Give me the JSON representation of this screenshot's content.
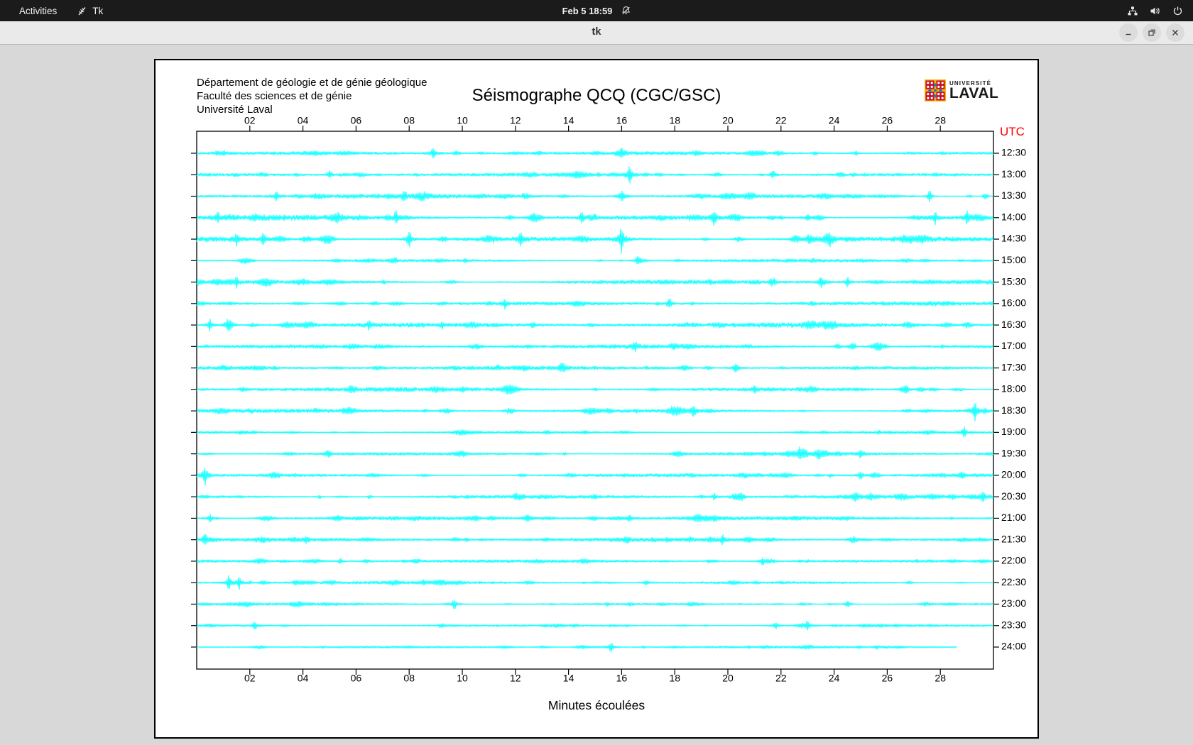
{
  "top_bar": {
    "activities_label": "Activities",
    "app_menu_label": "Tk",
    "clock": "Feb 5 18:59"
  },
  "titlebar": {
    "title": "tk"
  },
  "app": {
    "institution_lines": [
      "Département de géologie et de génie géologique",
      "Faculté des sciences et de génie",
      "Université Laval"
    ],
    "title": "Séismographe QCQ (CGC/GSC)",
    "logo": {
      "top": "UNIVERSITÉ",
      "bottom": "LAVAL"
    },
    "utc_label": "UTC",
    "x_axis_label": "Minutes écoulées"
  },
  "colors": {
    "trace": "#00ffff",
    "utc_label": "#ff0000",
    "plot_frame": "#000000",
    "topbar_bg": "#1b1b1b",
    "titlebar_bg": "#eaeaea",
    "desktop_bg": "#d8d8d8"
  },
  "chart_data": {
    "type": "line",
    "subtype": "helicorder-seismogram",
    "title": "Séismographe QCQ (CGC/GSC)",
    "x_label": "Minutes écoulées",
    "right_axis_label": "UTC",
    "x_range_minutes": [
      0,
      30
    ],
    "x_tick_minutes": [
      2,
      4,
      6,
      8,
      10,
      12,
      14,
      16,
      18,
      20,
      22,
      24,
      26,
      28
    ],
    "x_tick_labels": [
      "02",
      "04",
      "06",
      "08",
      "10",
      "12",
      "14",
      "16",
      "18",
      "20",
      "22",
      "24",
      "26",
      "28"
    ],
    "trace_interval_minutes": 30,
    "traces": [
      {
        "utc": "12:30",
        "activity": 0.9,
        "events": [
          [
            8.9,
            5
          ],
          [
            16.0,
            4
          ]
        ]
      },
      {
        "utc": "13:00",
        "activity": 0.9,
        "events": [
          [
            5.0,
            4
          ],
          [
            16.3,
            9
          ],
          [
            21.7,
            5
          ]
        ]
      },
      {
        "utc": "13:30",
        "activity": 1.2,
        "events": [
          [
            3.0,
            5
          ],
          [
            7.8,
            5
          ],
          [
            16.0,
            4
          ],
          [
            27.6,
            6
          ]
        ]
      },
      {
        "utc": "14:00",
        "activity": 1.5,
        "events": [
          [
            0.8,
            5
          ],
          [
            7.5,
            7
          ],
          [
            14.5,
            5
          ],
          [
            19.5,
            6
          ],
          [
            23.0,
            5
          ],
          [
            27.8,
            7
          ],
          [
            29.0,
            6
          ]
        ]
      },
      {
        "utc": "14:30",
        "activity": 1.6,
        "events": [
          [
            1.5,
            6
          ],
          [
            2.5,
            6
          ],
          [
            8.0,
            8
          ],
          [
            12.2,
            6
          ],
          [
            16.0,
            17
          ]
        ]
      },
      {
        "utc": "15:00",
        "activity": 1.0,
        "events": [
          [
            16.6,
            5
          ]
        ]
      },
      {
        "utc": "15:30",
        "activity": 1.3,
        "events": [
          [
            1.5,
            5
          ],
          [
            23.5,
            6
          ],
          [
            24.5,
            5
          ]
        ]
      },
      {
        "utc": "16:00",
        "activity": 1.0,
        "events": [
          [
            11.6,
            5
          ],
          [
            17.8,
            4
          ]
        ]
      },
      {
        "utc": "16:30",
        "activity": 1.3,
        "events": [
          [
            0.5,
            7
          ],
          [
            1.2,
            6
          ],
          [
            6.5,
            5
          ]
        ]
      },
      {
        "utc": "17:00",
        "activity": 1.0,
        "events": [
          [
            16.5,
            5
          ]
        ]
      },
      {
        "utc": "17:30",
        "activity": 1.0,
        "events": [
          [
            13.8,
            5
          ],
          [
            20.3,
            6
          ]
        ]
      },
      {
        "utc": "18:00",
        "activity": 1.2,
        "events": [
          [
            21.0,
            5
          ],
          [
            26.7,
            4
          ]
        ]
      },
      {
        "utc": "18:30",
        "activity": 1.1,
        "events": [
          [
            18.7,
            6
          ],
          [
            29.3,
            10
          ]
        ]
      },
      {
        "utc": "19:00",
        "activity": 0.8,
        "events": [
          [
            28.9,
            5
          ]
        ]
      },
      {
        "utc": "19:30",
        "activity": 1.1,
        "events": [
          [
            22.7,
            6
          ],
          [
            25.0,
            5
          ]
        ]
      },
      {
        "utc": "20:00",
        "activity": 1.0,
        "events": [
          [
            0.3,
            9
          ],
          [
            25.0,
            4
          ]
        ]
      },
      {
        "utc": "20:30",
        "activity": 1.0,
        "events": [
          [
            19.5,
            4
          ],
          [
            29.6,
            6
          ]
        ]
      },
      {
        "utc": "21:00",
        "activity": 1.0,
        "events": [
          [
            0.5,
            4
          ],
          [
            16.3,
            4
          ]
        ]
      },
      {
        "utc": "21:30",
        "activity": 1.0,
        "events": [
          [
            0.3,
            6
          ],
          [
            19.8,
            5
          ]
        ]
      },
      {
        "utc": "22:00",
        "activity": 0.8,
        "events": [
          [
            21.3,
            4
          ]
        ]
      },
      {
        "utc": "22:30",
        "activity": 0.8,
        "events": [
          [
            1.2,
            9
          ],
          [
            1.6,
            7
          ]
        ]
      },
      {
        "utc": "23:00",
        "activity": 0.7,
        "events": [
          [
            9.7,
            5
          ],
          [
            24.5,
            4
          ]
        ]
      },
      {
        "utc": "23:30",
        "activity": 0.7,
        "events": [
          [
            2.2,
            5
          ],
          [
            21.8,
            4
          ],
          [
            23.0,
            4
          ]
        ]
      },
      {
        "utc": "24:00",
        "activity": 0.7,
        "events": [
          [
            15.6,
            5
          ]
        ],
        "end_minute": 28.6
      }
    ]
  }
}
